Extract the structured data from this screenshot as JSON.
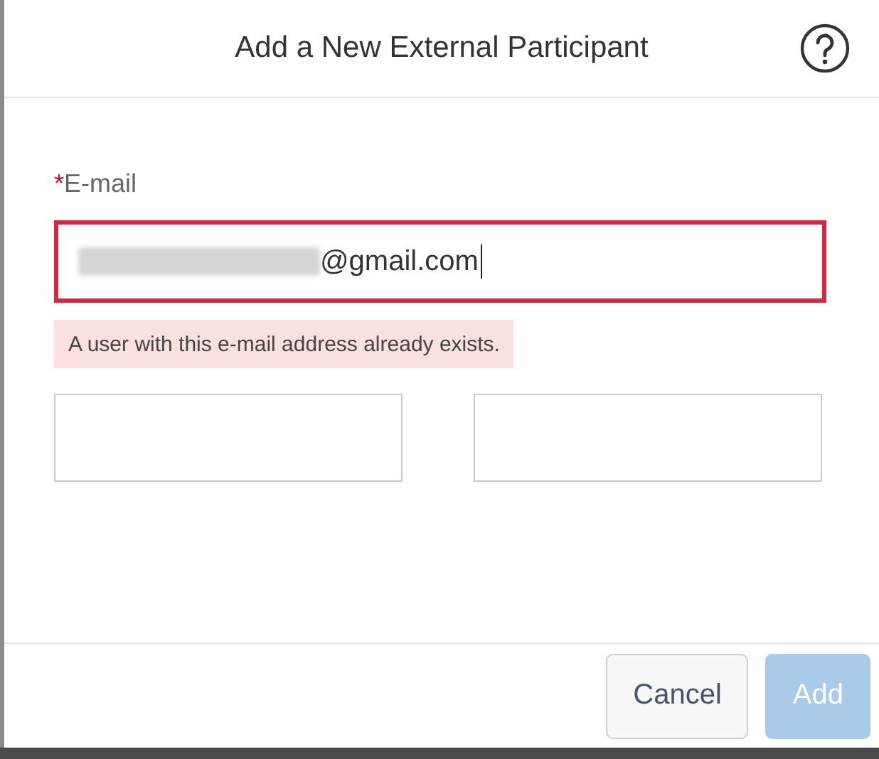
{
  "dialog": {
    "title": "Add a New External Participant",
    "help": true
  },
  "email": {
    "required_mark": "*",
    "label": "E-mail",
    "value": "@gmail.com",
    "redacted": true,
    "error": true,
    "message": "A user with this e-mail address already exists."
  },
  "name_fields": [
    {
      "kind": "text"
    },
    {
      "kind": "text"
    }
  ],
  "buttons": [
    {
      "label": "Cancel",
      "kind": "secondary",
      "disabled": false
    },
    {
      "label": "Add",
      "kind": "primary",
      "disabled": true
    }
  ]
}
